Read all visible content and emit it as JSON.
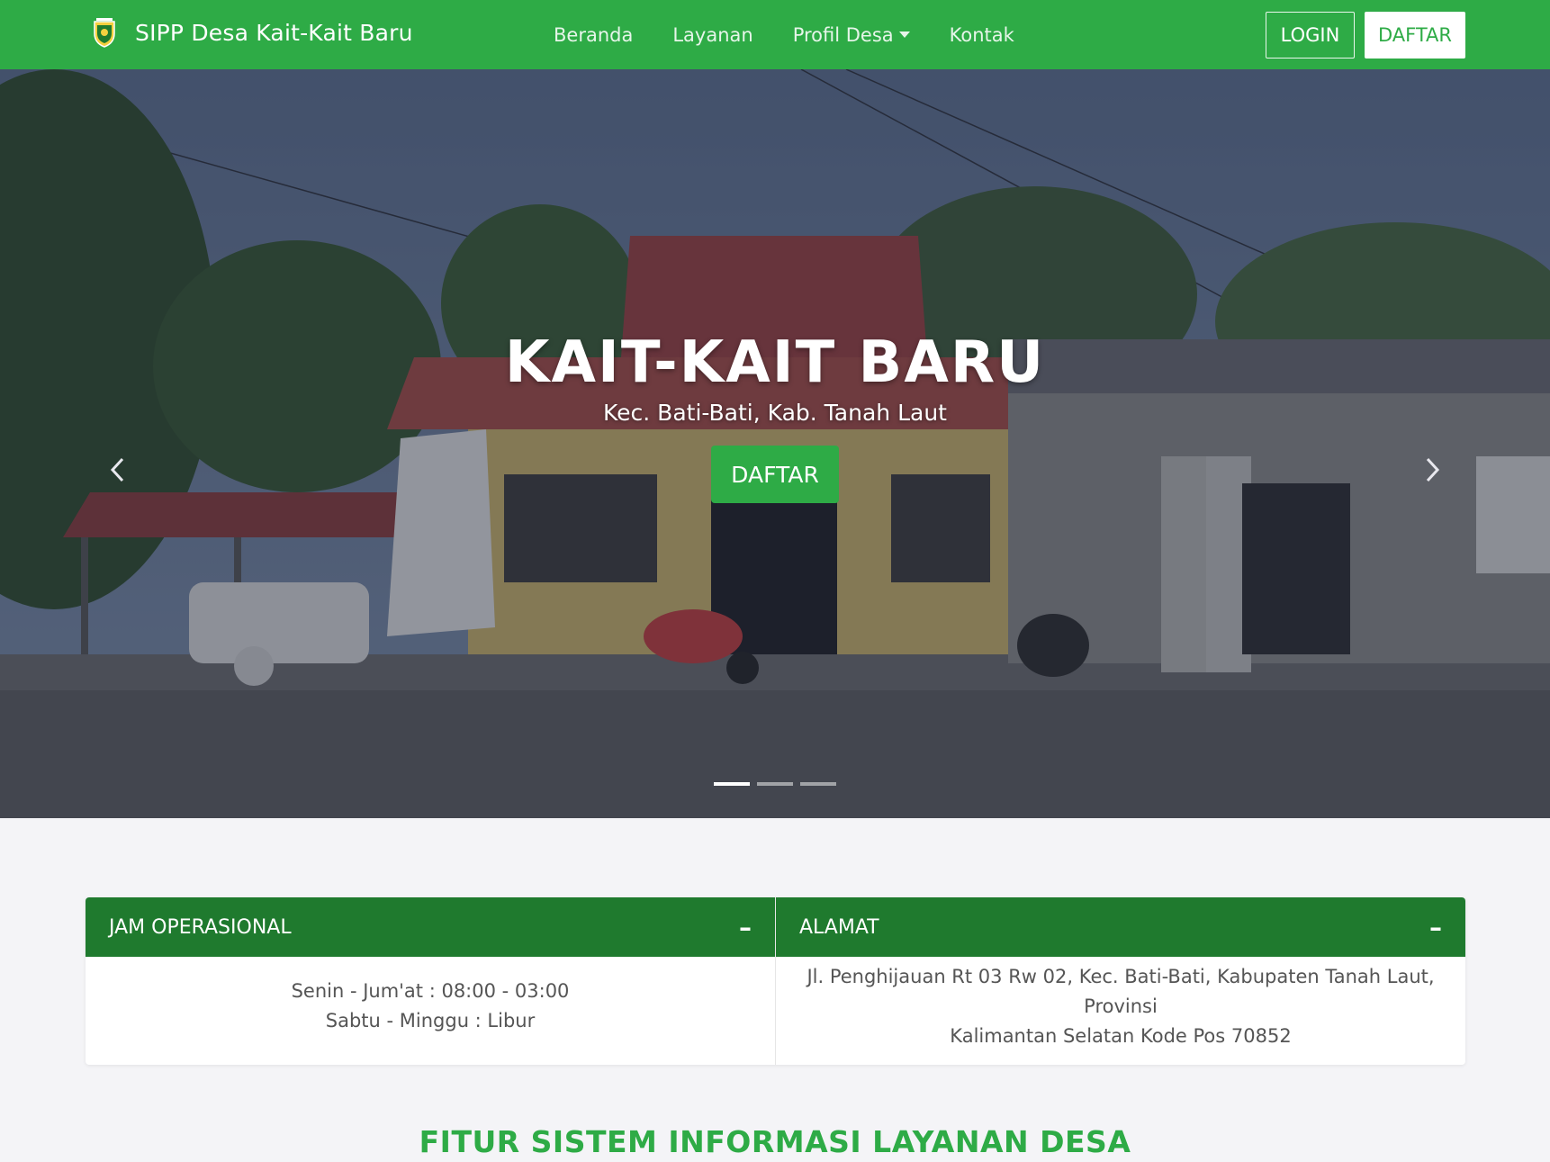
{
  "navbar": {
    "brand": "SIPP Desa Kait-Kait Baru",
    "links": [
      {
        "label": "Beranda"
      },
      {
        "label": "Layanan"
      },
      {
        "label": "Profil Desa"
      },
      {
        "label": "Kontak"
      }
    ],
    "login_label": "LOGIN",
    "register_label": "DAFTAR"
  },
  "hero": {
    "title": "KAIT-KAIT BARU",
    "subtitle": "Kec. Bati-Bati, Kab. Tanah Laut",
    "button_label": "DAFTAR",
    "slide_count": 3,
    "active_slide": 1,
    "prev_icon": "chevron-left-icon",
    "next_icon": "chevron-right-icon"
  },
  "panels": {
    "hours": {
      "title": "JAM OPERASIONAL",
      "line1": "Senin - Jum'at : 08:00 - 03:00",
      "line2": "Sabtu - Minggu : Libur"
    },
    "address": {
      "title": "ALAMAT",
      "line1": "Jl. Penghijauan Rt 03 Rw 02, Kec. Bati-Bati, Kabupaten Tanah Laut, Provinsi",
      "line2": "Kalimantan Selatan Kode Pos 70852"
    },
    "collapse_symbol": "–"
  },
  "section": {
    "title": "FITUR SISTEM INFORMASI LAYANAN DESA"
  },
  "colors": {
    "primary": "#2eab46",
    "panel_header": "#1f7a2e",
    "background": "#f4f4f7"
  }
}
